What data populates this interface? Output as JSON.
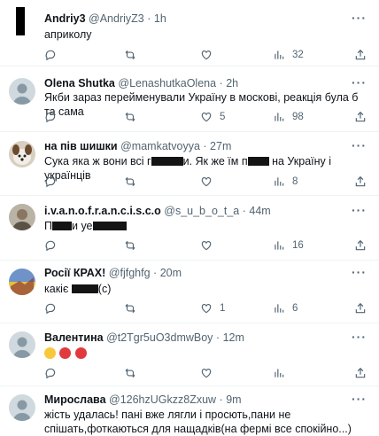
{
  "colors": {
    "text": "#0f1419",
    "muted": "#536471",
    "border": "#eff3f4"
  },
  "tweets": [
    {
      "name": "Andriy3",
      "handle": "@AndriyZ3",
      "sep": "·",
      "time": "1h",
      "text": "априколу",
      "replies": "",
      "retweets": "",
      "likes": "",
      "views": "32",
      "avatar": "black-square"
    },
    {
      "name": "Olena Shutka",
      "handle": "@LenashutkaOlena",
      "sep": "·",
      "time": "2h",
      "text": "Якби зараз перейменували Україну в москові, реакція була б та сама",
      "replies": "",
      "retweets": "",
      "likes": "5",
      "views": "98",
      "avatar": "gray-default"
    },
    {
      "name": "на пів шишки",
      "handle": "@mamkatvoyya",
      "sep": "·",
      "time": "27m",
      "text_a": "Сука яка ж вони всі г",
      "text_b": "и. Як же їм п",
      "text_c": " на Україну і українців",
      "replies": "",
      "retweets": "",
      "likes": "",
      "views": "8",
      "avatar": "dog-photo"
    },
    {
      "name": "i.v.a.n.o.f.r.a.n.c.i.s.c.o",
      "handle": "@s_u_b_o_t_a",
      "sep": "·",
      "time": "44m",
      "text_a": "П",
      "text_b": "и уе",
      "replies": "",
      "retweets": "",
      "likes": "",
      "views": "16",
      "avatar": "person-photo"
    },
    {
      "name": "Росії КРАХ!",
      "handle": "@fjfghfg",
      "sep": "·",
      "time": "20m",
      "text_a": "какіє ",
      "text_b": "(с)",
      "replies": "",
      "retweets": "",
      "likes": "1",
      "views": "6",
      "avatar": "flag-photo"
    },
    {
      "name": "Валентина",
      "handle": "@t2Tgr5uO3dmwBoy",
      "sep": "·",
      "time": "12m",
      "emojis": [
        "astonished-face-emoji",
        "angry-face-emoji",
        "angry-face-emoji"
      ],
      "replies": "",
      "retweets": "",
      "likes": "",
      "views": "",
      "avatar": "gray-default"
    },
    {
      "name": "Мирослава",
      "handle": "@126hzUGkzz8Zxuw",
      "sep": "·",
      "time": "9m",
      "text": "жість удалась! пані вже лягли і просють,пани не спішать,фоткаються для нащадків(на фермі все спокійно...)",
      "avatar": "gray-default"
    }
  ]
}
